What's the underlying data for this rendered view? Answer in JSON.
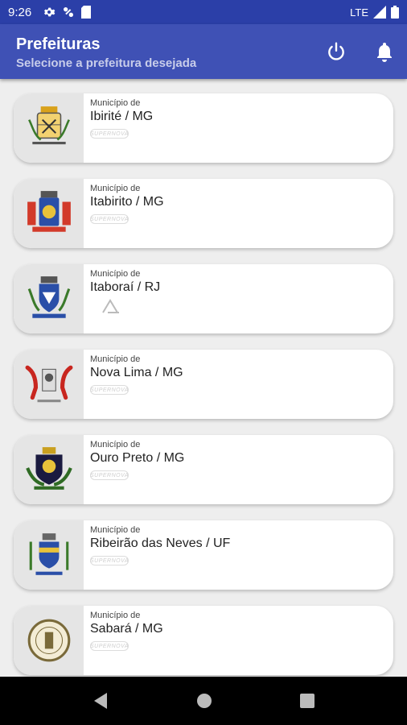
{
  "status": {
    "time": "9:26",
    "network": "LTE"
  },
  "header": {
    "title": "Prefeituras",
    "subtitle": "Selecione a prefeitura desejada"
  },
  "prefeituras": [
    {
      "prefix": "Município de",
      "name": "Ibirité / MG",
      "brand": "SUPERNOVA"
    },
    {
      "prefix": "Município de",
      "name": "Itabirito / MG",
      "brand": "SUPERNOVA"
    },
    {
      "prefix": "Município de",
      "name": "Itaboraí / RJ",
      "brand": ""
    },
    {
      "prefix": "Município de",
      "name": "Nova Lima / MG",
      "brand": "SUPERNOVA"
    },
    {
      "prefix": "Município de",
      "name": "Ouro Preto / MG",
      "brand": "SUPERNOVA"
    },
    {
      "prefix": "Município de",
      "name": "Ribeirão das Neves / UF",
      "brand": "SUPERNOVA"
    },
    {
      "prefix": "Município de",
      "name": "Sabará / MG",
      "brand": "SUPERNOVA"
    }
  ],
  "icons": {
    "power": "power-icon",
    "bell": "bell-icon",
    "back": "back-triangle-icon",
    "home": "home-circle-icon",
    "recents": "recents-square-icon"
  },
  "colors": {
    "status_bar": "#2b3fa8",
    "app_bar": "#3f51b5"
  }
}
